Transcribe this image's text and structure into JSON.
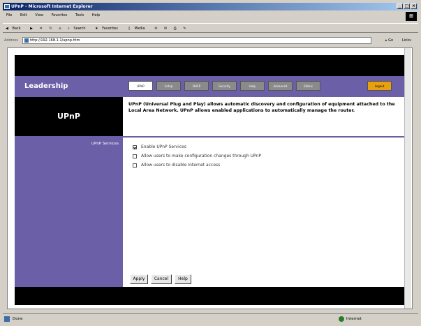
{
  "window": {
    "title": "UPnP - Microsoft Internet Explorer"
  },
  "menubar": [
    "File",
    "Edit",
    "View",
    "Favorites",
    "Tools",
    "Help"
  ],
  "toolbar": {
    "back": "Back",
    "search": "Search",
    "favorites": "Favorites",
    "media": "Media"
  },
  "addressbar": {
    "label": "Address",
    "url": "http://192.168.1.1/upnp.htm",
    "go": "Go",
    "links": "Links"
  },
  "page": {
    "logo": "Leadership",
    "tabs": [
      {
        "label": "UPnP",
        "active": true
      },
      {
        "label": "Setup",
        "active": false
      },
      {
        "label": "DHCP",
        "active": false
      },
      {
        "label": "Security",
        "active": false
      },
      {
        "label": "Help",
        "active": false
      },
      {
        "label": "Advanced",
        "active": false
      },
      {
        "label": "Status",
        "active": false
      },
      {
        "label": "Logout",
        "active": false
      }
    ],
    "section_title": "UPnP",
    "description": "UPnP (Universal Plug and Play) allows automatic discovery and configuration of equipment attached to the Local Area Network. UPnP allows enabled applications to automatically manage the router.",
    "settings_label": "UPnP Services",
    "options": [
      {
        "label": "Enable UPnP Services",
        "checked": true
      },
      {
        "label": "Allow users to make configuration changes through UPnP",
        "checked": false
      },
      {
        "label": "Allow users to disable Internet access",
        "checked": false
      }
    ],
    "buttons": {
      "apply": "Apply",
      "cancel": "Cancel",
      "help": "Help"
    }
  },
  "statusbar": {
    "status": "Done",
    "zone": "Internet"
  }
}
